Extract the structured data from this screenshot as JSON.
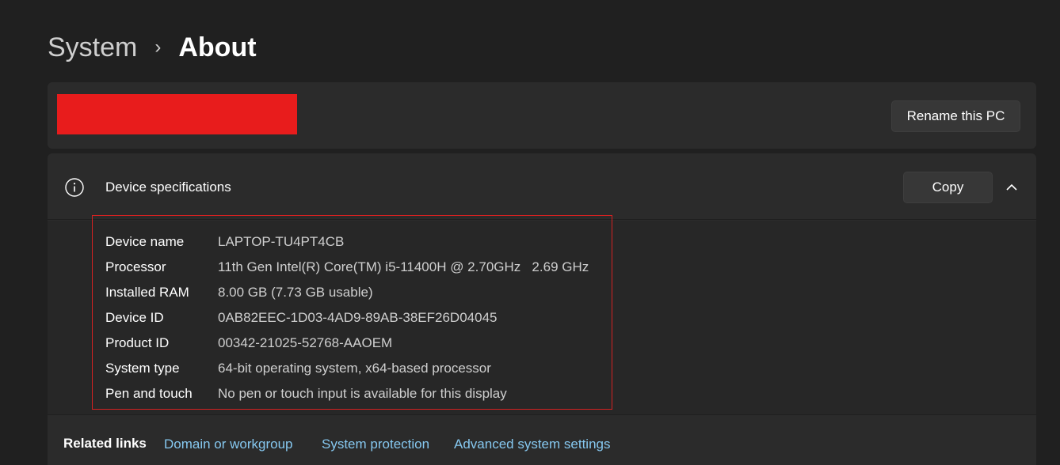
{
  "breadcrumb": {
    "parent": "System",
    "separator": "›",
    "current": "About"
  },
  "pc_name_card": {
    "rename_label": "Rename this PC",
    "redaction_color": "#e81c1c"
  },
  "device_specs": {
    "title": "Device specifications",
    "icon": "info-icon",
    "copy_label": "Copy",
    "collapse_icon": "chevron-up-icon",
    "rows": [
      {
        "label": "Device name",
        "value": "LAPTOP-TU4PT4CB"
      },
      {
        "label": "Processor",
        "value": "11th Gen Intel(R) Core(TM) i5-11400H @ 2.70GHz   2.69 GHz"
      },
      {
        "label": "Installed RAM",
        "value": "8.00 GB (7.73 GB usable)"
      },
      {
        "label": "Device ID",
        "value": "0AB82EEC-1D03-4AD9-89AB-38EF26D04045"
      },
      {
        "label": "Product ID",
        "value": "00342-21025-52768-AAOEM"
      },
      {
        "label": "System type",
        "value": "64-bit operating system, x64-based processor"
      },
      {
        "label": "Pen and touch",
        "value": "No pen or touch input is available for this display"
      }
    ]
  },
  "related_links": {
    "label": "Related links",
    "links": [
      "Domain or workgroup",
      "System protection",
      "Advanced system settings"
    ]
  },
  "colors": {
    "background": "#202020",
    "card": "#2b2b2b",
    "accent_link": "#86c8f0",
    "highlight_border": "#d52121"
  }
}
